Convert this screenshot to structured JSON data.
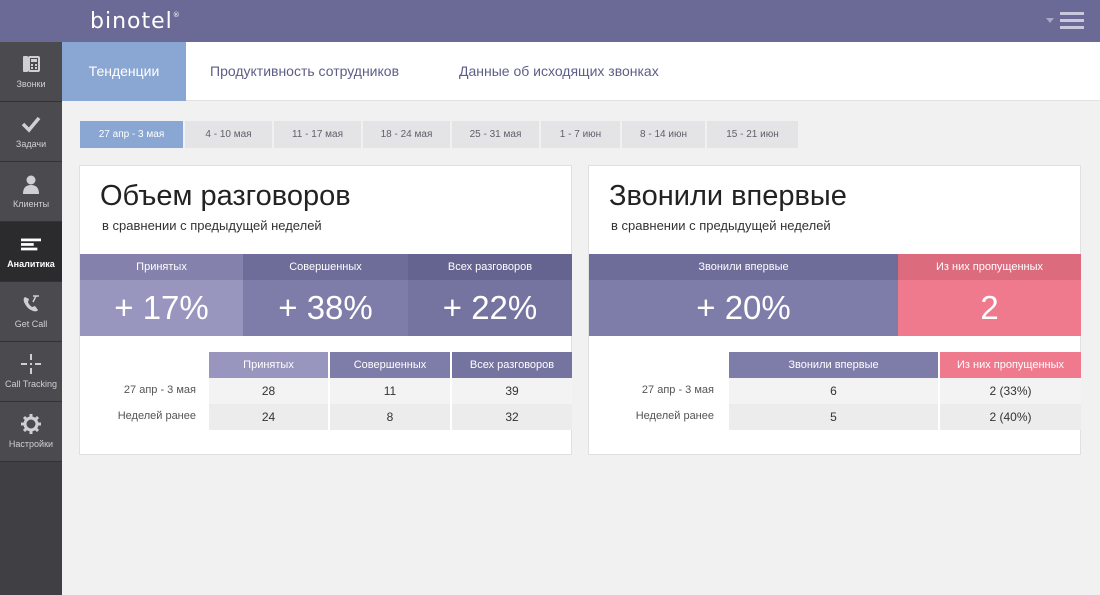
{
  "app": {
    "logo": "binotel",
    "logo_mark": "®"
  },
  "colors": {
    "header": "#6b6a96",
    "accent": "#8aa6d3",
    "kpi1": "#8e8cb5",
    "kpi2": "#76749f",
    "kpi3": "#6e6c98",
    "missed": "#ef7a8e",
    "sidebar": "#3f3f44"
  },
  "sidebar": {
    "items": [
      {
        "label": "Звонки",
        "icon": "phone-icon"
      },
      {
        "label": "Задачи",
        "icon": "check-icon"
      },
      {
        "label": "Клиенты",
        "icon": "person-icon"
      },
      {
        "label": "Аналитика",
        "icon": "analytics-icon"
      },
      {
        "label": "Get Call",
        "icon": "get-call-icon"
      },
      {
        "label": "Call Tracking",
        "icon": "call-tracking-icon"
      },
      {
        "label": "Настройки",
        "icon": "gear-icon"
      }
    ]
  },
  "tabs": [
    {
      "label": "Тенденции"
    },
    {
      "label": "Продуктивность сотрудников"
    },
    {
      "label": "Данные об исходящих звонках"
    }
  ],
  "weeks": [
    "27 апр - 3 мая",
    "4 - 10 мая",
    "11 - 17 мая",
    "18 - 24 мая",
    "25 - 31 мая",
    "1 - 7 июн",
    "8 - 14 июн",
    "15 - 21 июн"
  ],
  "card1": {
    "title": "Объем разговоров",
    "subtitle": "в сравнении с предыдущей неделей",
    "kpis": [
      {
        "label": "Принятых",
        "value": "+ 17%"
      },
      {
        "label": "Совершенных",
        "value": "+ 38%"
      },
      {
        "label": "Всех разговоров",
        "value": "+ 22%"
      }
    ],
    "table": {
      "headers": [
        "Принятых",
        "Совершенных",
        "Всех разговоров"
      ],
      "rows": [
        {
          "label": "27 апр - 3 мая",
          "values": [
            "28",
            "11",
            "39"
          ]
        },
        {
          "label": "Неделей ранее",
          "values": [
            "24",
            "8",
            "32"
          ]
        }
      ]
    }
  },
  "card2": {
    "title": "Звонили впервые",
    "subtitle": "в сравнении с предыдущей неделей",
    "kpis": [
      {
        "label": "Звонили впервые",
        "value": "+ 20%"
      },
      {
        "label": "Из них пропущенных",
        "value": "2"
      }
    ],
    "table": {
      "headers": [
        "Звонили впервые",
        "Из них пропущенных"
      ],
      "rows": [
        {
          "label": "27 апр - 3 мая",
          "values": [
            "6",
            "2 (33%)"
          ]
        },
        {
          "label": "Неделей ранее",
          "values": [
            "5",
            "2 (40%)"
          ]
        }
      ]
    }
  }
}
